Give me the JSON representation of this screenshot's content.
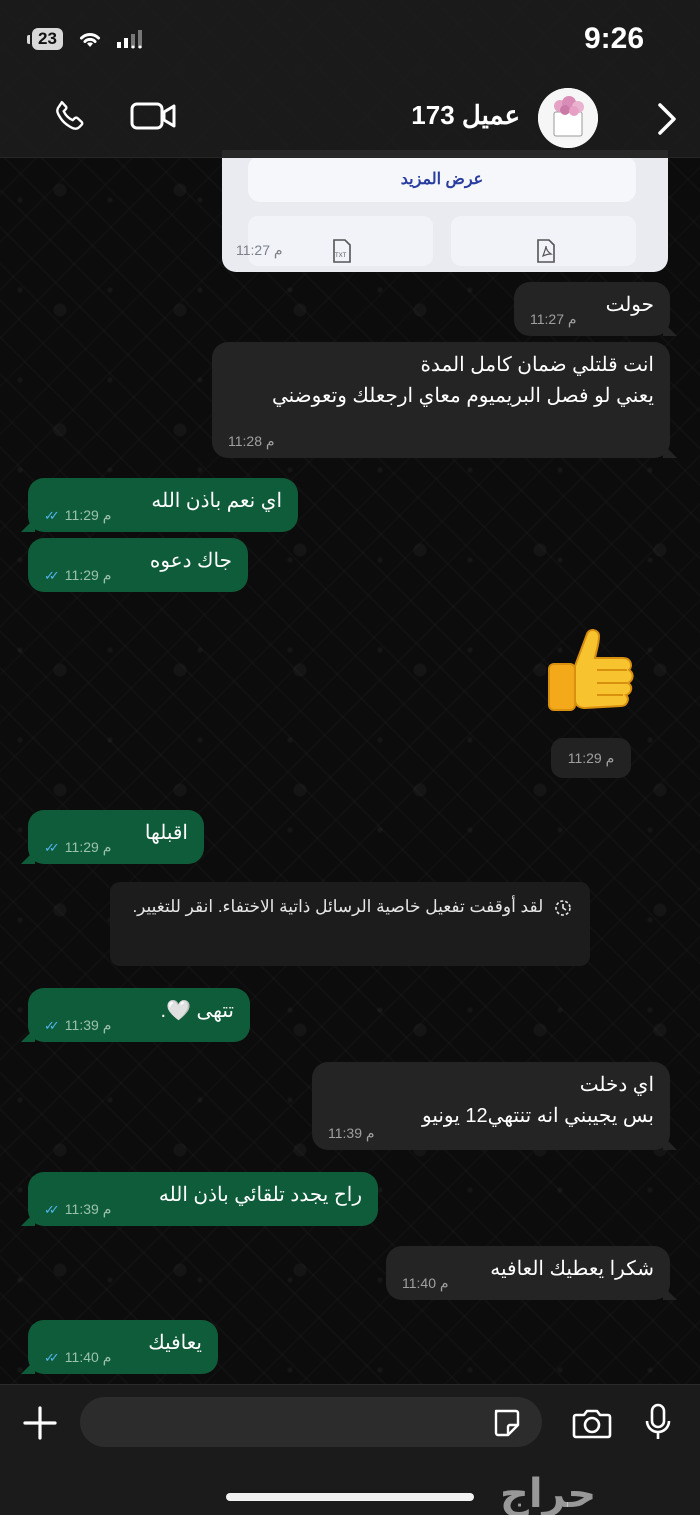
{
  "status_bar": {
    "time": "9:26",
    "battery": "23"
  },
  "header": {
    "contact_name": "عميل 173"
  },
  "preview_card": {
    "button_label": "عرض المزيد",
    "time": "11:27 م"
  },
  "messages": [
    {
      "text": "حولت",
      "time": "11:27 م"
    },
    {
      "line1": "انت قلتلي ضمان كامل المدة",
      "line2": "يعني لو فصل البريميوم معاي ارجعلك وتعوضني",
      "time": "11:28 م"
    },
    {
      "text": "اي نعم باذن الله",
      "time": "11:29 م"
    },
    {
      "text": "جاك دعوه",
      "time": "11:29 م"
    },
    {
      "emoji": "👍",
      "time": "11:29 م"
    },
    {
      "text": "اقبلها",
      "time": "11:29 م"
    },
    {
      "text": "تتهى 🤍.",
      "time": "11:39 م"
    },
    {
      "line1": "اي دخلت",
      "line2": "بس يجيبني انه تنتهي12 يونيو",
      "time": "11:39 م"
    },
    {
      "text": "راح يجدد تلقائي باذن الله",
      "time": "11:39 م"
    },
    {
      "text": "شكرا يعطيك العافيه",
      "time": "11:40 م"
    },
    {
      "text": "يعافيك",
      "time": "11:40 م"
    }
  ],
  "system_message": {
    "text": "لقد أوقفت تفعيل خاصية الرسائل ذاتية الاختفاء. انقر للتغيير."
  },
  "input": {
    "value": ""
  },
  "watermark": "حراج"
}
